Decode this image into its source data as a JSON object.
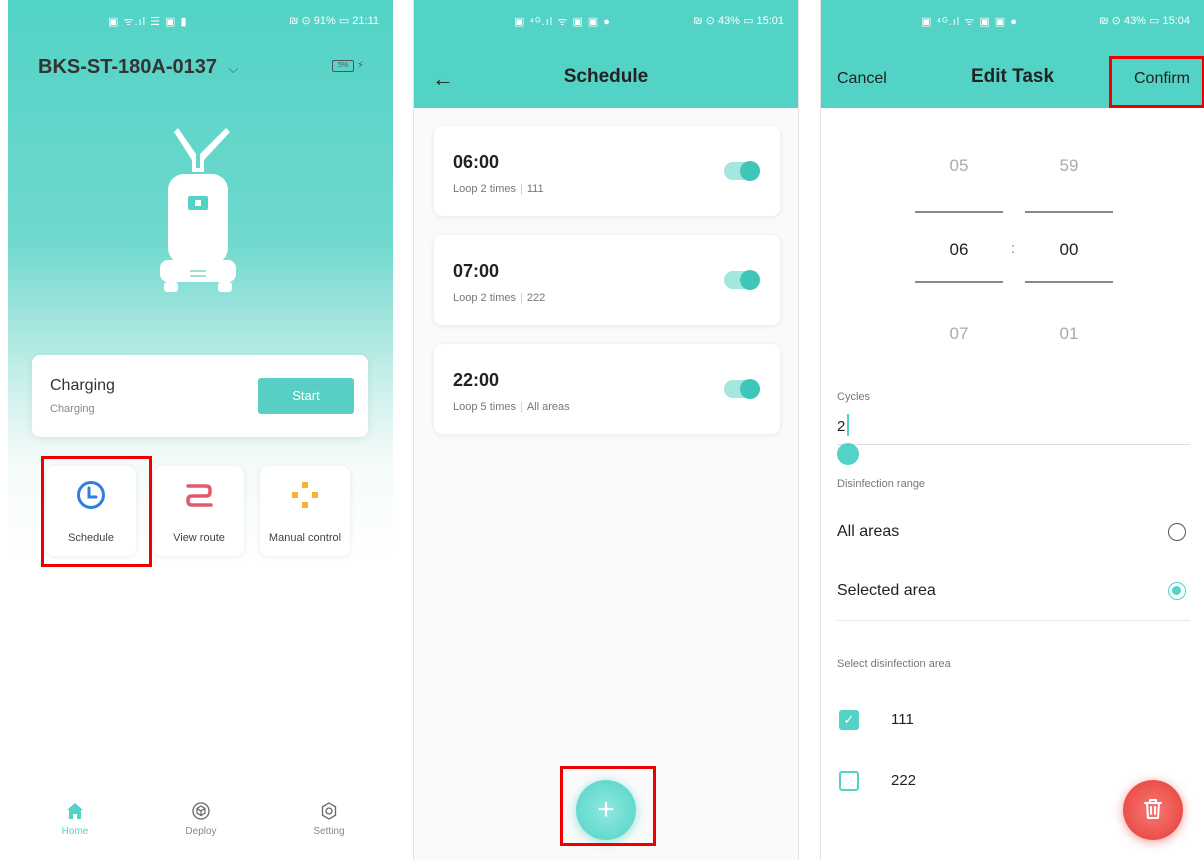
{
  "panel1": {
    "status_bar": {
      "left": "▣ ᯤ.ıl ☰ ▣ ▮",
      "right": "₪ ⊙ 91% ▭ 21:11"
    },
    "device_name": "BKS-ST-180A-0137",
    "battery_text": "5%",
    "status": {
      "title": "Charging",
      "subtitle": "Charging"
    },
    "start_label": "Start",
    "tiles": [
      {
        "label": "Schedule",
        "icon": "clock-icon"
      },
      {
        "label": "View route",
        "icon": "route-icon"
      },
      {
        "label": "Manual control",
        "icon": "dpad-icon"
      }
    ],
    "bottom_nav": [
      {
        "label": "Home",
        "icon": "home-icon"
      },
      {
        "label": "Deploy",
        "icon": "cube-icon"
      },
      {
        "label": "Setting",
        "icon": "gear-icon"
      }
    ],
    "colors": {
      "accent": "#52d3c6",
      "route": "#e05a6e",
      "clock": "#2f7fe0",
      "dpad": "#f2b632"
    }
  },
  "panel2": {
    "status_bar": {
      "left": "▣ ⁴ᴳ.ıl ᯤ ▣ ▣ ●",
      "right": "₪ ⊙ 43% ▭ 15:01"
    },
    "title": "Schedule",
    "tasks": [
      {
        "time": "06:00",
        "loop": "Loop 2 times",
        "area": "111"
      },
      {
        "time": "07:00",
        "loop": "Loop 2 times",
        "area": "222"
      },
      {
        "time": "22:00",
        "loop": "Loop 5 times",
        "area": "All areas"
      }
    ],
    "add_label": "+"
  },
  "panel3": {
    "status_bar": {
      "left": "▣ ⁴ᴳ.ıl ᯤ ▣ ▣ ●",
      "right": "₪ ⊙ 43% ▭ 15:04"
    },
    "cancel_label": "Cancel",
    "title": "Edit Task",
    "confirm_label": "Confirm",
    "hours": [
      "05",
      "06",
      "07"
    ],
    "minutes": [
      "59",
      "00",
      "01"
    ],
    "colon": ":",
    "cycles_label": "Cycles",
    "cycles_value": "2",
    "range_label": "Disinfection range",
    "range_options": [
      {
        "label": "All areas",
        "selected": false
      },
      {
        "label": "Selected area",
        "selected": true
      }
    ],
    "select_area_label": "Select disinfection area",
    "areas": [
      {
        "label": "111",
        "checked": true
      },
      {
        "label": "222",
        "checked": false
      }
    ]
  }
}
